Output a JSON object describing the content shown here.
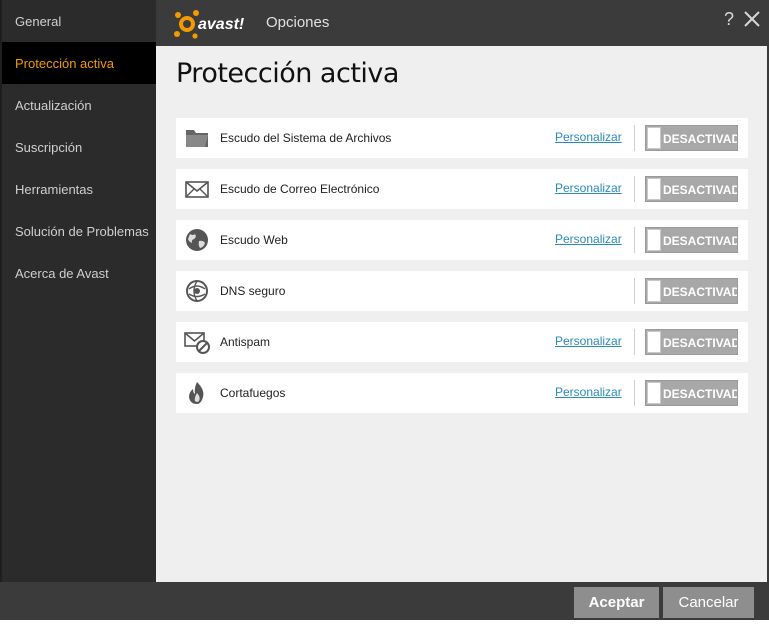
{
  "app": {
    "brand": "avast!",
    "window_title": "Opciones",
    "help_glyph": "?"
  },
  "sidebar": {
    "items": [
      {
        "label": "General",
        "active": false
      },
      {
        "label": "Protección activa",
        "active": true
      },
      {
        "label": "Actualización",
        "active": false
      },
      {
        "label": "Suscripción",
        "active": false
      },
      {
        "label": "Herramientas",
        "active": false
      },
      {
        "label": "Solución de Problemas",
        "active": false
      },
      {
        "label": "Acerca de Avast",
        "active": false
      }
    ]
  },
  "main": {
    "title": "Protección activa",
    "shields": [
      {
        "name": "Escudo del Sistema de Archivos",
        "icon": "folder-icon",
        "link": "Personalizar",
        "state": "DESACTIVADO"
      },
      {
        "name": "Escudo de Correo Electrónico",
        "icon": "envelope-icon",
        "link": "Personalizar",
        "state": "DESACTIVADO"
      },
      {
        "name": "Escudo Web",
        "icon": "globe-icon",
        "link": "Personalizar",
        "state": "DESACTIVADO"
      },
      {
        "name": "DNS seguro",
        "icon": "network-globe-icon",
        "link": "",
        "state": "DESACTIVADO"
      },
      {
        "name": "Antispam",
        "icon": "envelope-blocked-icon",
        "link": "Personalizar",
        "state": "DESACTIVADO"
      },
      {
        "name": "Cortafuegos",
        "icon": "flame-icon",
        "link": "Personalizar",
        "state": "DESACTIVADO"
      }
    ]
  },
  "footer": {
    "accept_label": "Aceptar",
    "cancel_label": "Cancelar"
  },
  "colors": {
    "accent": "#f29a00",
    "link": "#2a8ab8",
    "sidebar_bg": "#2b2b2b",
    "content_bg": "#efefef",
    "toggle_off": "#a8a8a8"
  }
}
